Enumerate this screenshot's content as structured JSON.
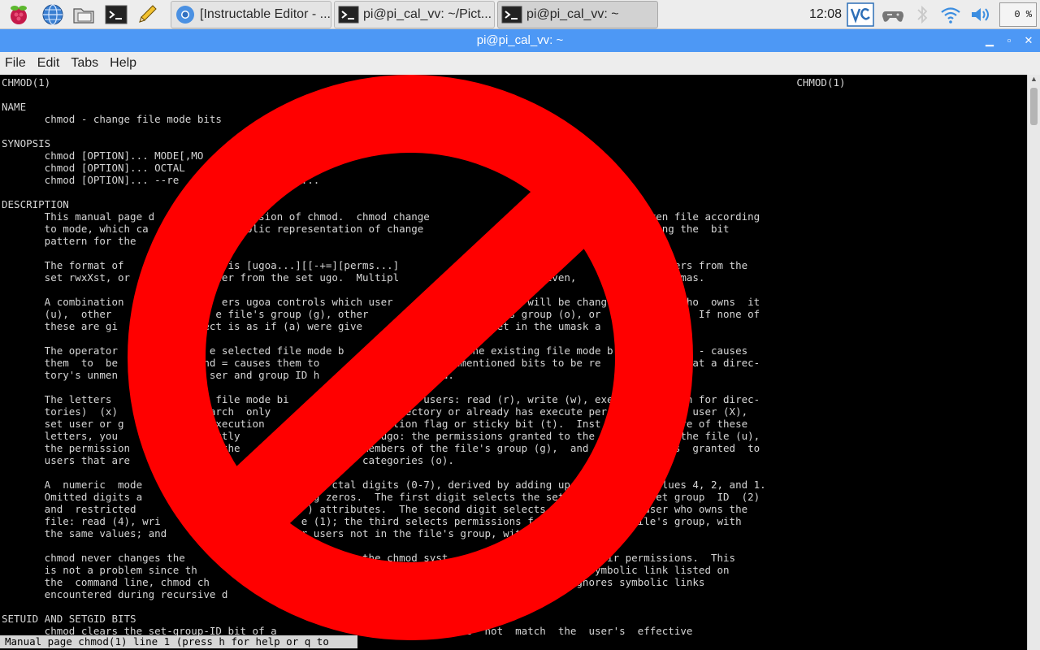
{
  "taskbar": {
    "launchers": [
      {
        "icon": "raspberry-menu-icon"
      },
      {
        "icon": "globe-browser-icon"
      },
      {
        "icon": "folder-icon"
      },
      {
        "icon": "terminal-icon"
      },
      {
        "icon": "pencil-icon"
      }
    ],
    "tasks": [
      {
        "label": "[Instructable Editor - ...",
        "icon": "chromium-icon"
      },
      {
        "label": "pi@pi_cal_vv: ~/Pict...",
        "icon": "terminal-icon"
      },
      {
        "label": "pi@pi_cal_vv: ~",
        "icon": "terminal-icon"
      }
    ],
    "clock": "12:08",
    "cpu_usage": "0 %"
  },
  "window": {
    "title": "pi@pi_cal_vv: ~",
    "menu": [
      "File",
      "Edit",
      "Tabs",
      "Help"
    ]
  },
  "terminal": {
    "lines": [
      "CHMOD(1)                                                                                                                          CHMOD(1)",
      "",
      "NAME",
      "       chmod - change file mode bits",
      "",
      "SYNOPSIS",
      "       chmod [OPTION]... MODE[,MO",
      "       chmod [OPTION]... OCTAL",
      "       chmod [OPTION]... --re                    ...",
      "",
      "DESCRIPTION",
      "       This manual page d            U version of chmod.  chmod change                                   iven file according",
      "       to mode, which ca            symbolic representation of change                                resenting the  bit",
      "       pattern for the",
      "",
      "       The format of              de is [ugoa...][[-+=][perms...]                 is either               letters from the",
      "       set rwxXst, or              ter from the set ugo.  Multipl                can be given,              commas.",
      "",
      "       A combination                ers ugoa controls which user                  ile will be chang            who  owns  it",
      "       (u),  other                 e file's group (g), other                   ile's group (o), or            ).  If none of",
      "       these are gi              ect is as if (a) were give                 are set in the umask a          ted.",
      "",
      "       The operator               e selected file mode b                  o the existing file mode b         ile; - causes",
      "       them  to  be              nd = causes them to                  es unmentioned bits to be re             that a direc-",
      "       tory's unmen               ser and group ID h                  ted.",
      "",
      "       The letters               t file mode bi                   ed users: read (r), write (w), exe          rch for direc-",
      "       tories)  (x)               arch  only                   directory or already has execute per         some user (X),",
      "       set user or g              execution                  eletion flag or sticky bit (t).  Inst           more of these",
      "       letters, you              xactly                     s ugo: the permissions granted to the            s the file (u),",
      "       the permission              othe                    members of the file's group (g),  and  t          ns  granted  to",
      "       users that are                                      categories (o).",
      "",
      "       A  numeric  mode                               ctal digits (0-7), derived by adding up th            lues 4, 2, and 1.",
      "       Omitted digits a                            g zeros.  The first digit selects the set u            set group  ID  (2)",
      "       and  restricted                            ) attributes.  The second digit selects pe           e user who owns the",
      "       file: read (4), wri                       e (1); the third selects permissions for           he file's group, with",
      "       the same values; and                   ther users not in the file's group, wit",
      "",
      "       chmod never changes the                  lic links; the chmod syst                       their permissions.  This",
      "       is not a problem since th                 links are ne                               ach symbolic link listed on",
      "       the  command line, chmod ch                                                     chmod ignores symbolic links",
      "       encountered during recursive d",
      "",
      "SETUID AND SETGID BITS",
      "       chmod clears the set-group-ID bit of a                            does  not  match  the  user's  effective"
    ],
    "status_line": "Manual page chmod(1) line 1 (press h for help or q to"
  },
  "overlay": {
    "icon": "no-symbol-icon",
    "color": "#ff0000"
  }
}
